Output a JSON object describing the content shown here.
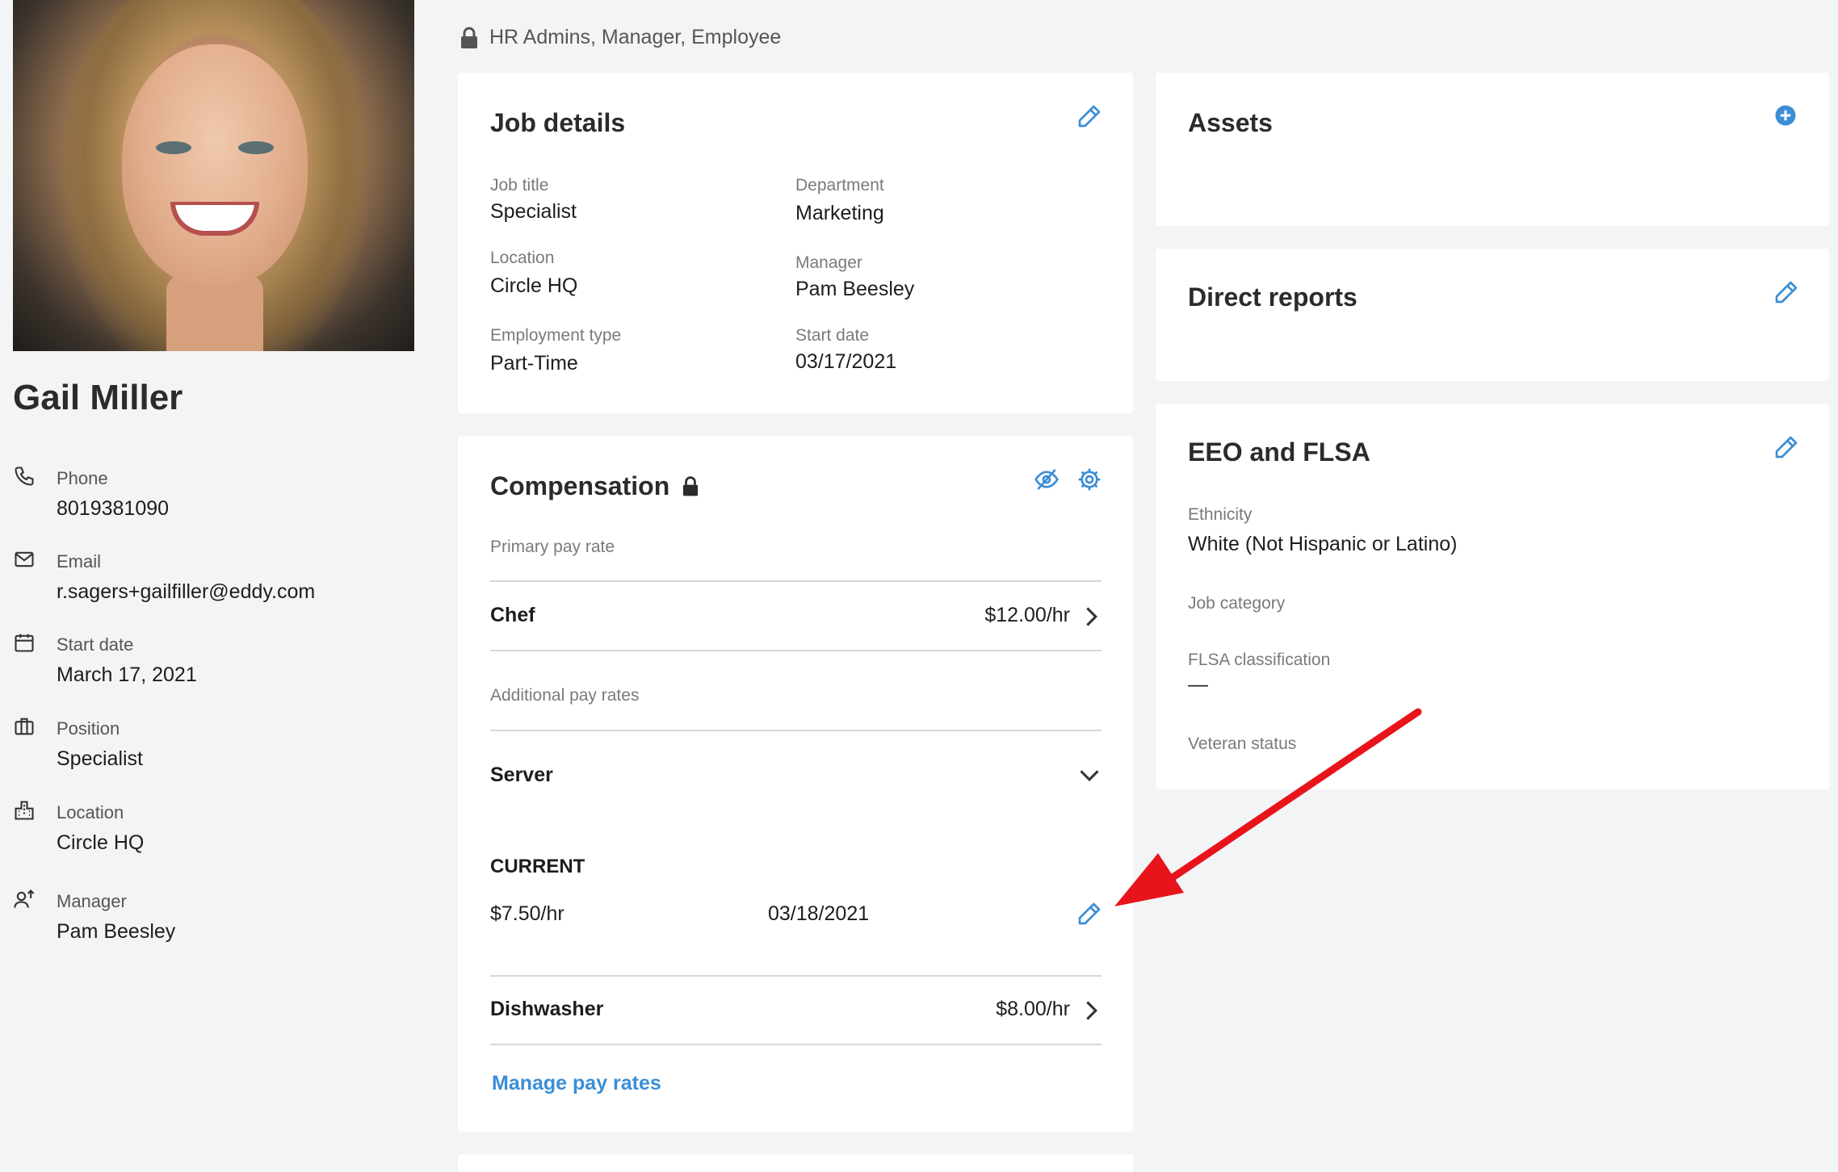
{
  "permissions": {
    "text": "HR Admins, Manager, Employee"
  },
  "profile": {
    "name": "Gail Miller",
    "items": [
      {
        "icon": "phone-icon",
        "label": "Phone",
        "value": "8019381090"
      },
      {
        "icon": "email-icon",
        "label": "Email",
        "value": "r.sagers+gailfiller@eddy.com"
      },
      {
        "icon": "calendar-icon",
        "label": "Start date",
        "value": "March 17, 2021"
      },
      {
        "icon": "briefcase-icon",
        "label": "Position",
        "value": "Specialist"
      },
      {
        "icon": "building-icon",
        "label": "Location",
        "value": "Circle HQ"
      },
      {
        "icon": "manager-icon",
        "label": "Manager",
        "value": "Pam Beesley"
      }
    ]
  },
  "job_details": {
    "title": "Job details",
    "job_title": {
      "label": "Job title",
      "value": "Specialist"
    },
    "department": {
      "label": "Department",
      "value": "Marketing"
    },
    "location": {
      "label": "Location",
      "value": "Circle HQ"
    },
    "manager": {
      "label": "Manager",
      "value": "Pam Beesley"
    },
    "employment_type": {
      "label": "Employment type",
      "value": "Part-Time"
    },
    "start_date": {
      "label": "Start date",
      "value": "03/17/2021"
    }
  },
  "compensation": {
    "title": "Compensation",
    "primary_label": "Primary pay rate",
    "primary": {
      "title": "Chef",
      "amount": "$12.00/hr"
    },
    "additional_label": "Additional pay rates",
    "server": {
      "title": "Server",
      "current_label": "CURRENT",
      "rate": "$7.50/hr",
      "date": "03/18/2021"
    },
    "dishwasher": {
      "title": "Dishwasher",
      "amount": "$8.00/hr"
    },
    "manage_link": "Manage pay rates"
  },
  "assets": {
    "title": "Assets"
  },
  "direct_reports": {
    "title": "Direct reports"
  },
  "eeo": {
    "title": "EEO and FLSA",
    "ethnicity": {
      "label": "Ethnicity",
      "value": "White (Not Hispanic or Latino)"
    },
    "job_category": {
      "label": "Job category"
    },
    "flsa": {
      "label": "FLSA classification",
      "value": "—"
    },
    "veteran": {
      "label": "Veteran status"
    }
  },
  "colors": {
    "accent": "#3b8ed6",
    "annotation_arrow": "#e8141b",
    "background": "#f3f4f6"
  }
}
